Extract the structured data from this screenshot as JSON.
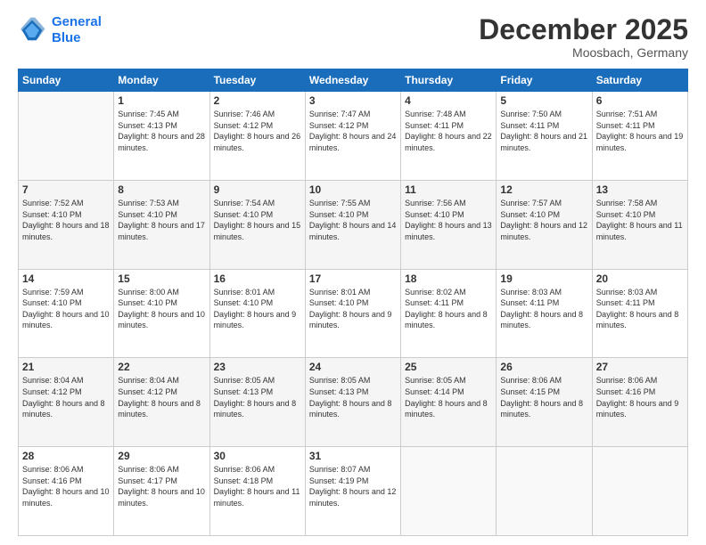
{
  "header": {
    "logo_line1": "General",
    "logo_line2": "Blue",
    "month": "December 2025",
    "location": "Moosbach, Germany"
  },
  "weekdays": [
    "Sunday",
    "Monday",
    "Tuesday",
    "Wednesday",
    "Thursday",
    "Friday",
    "Saturday"
  ],
  "weeks": [
    [
      {
        "day": "",
        "sunrise": "",
        "sunset": "",
        "daylight": ""
      },
      {
        "day": "1",
        "sunrise": "Sunrise: 7:45 AM",
        "sunset": "Sunset: 4:13 PM",
        "daylight": "Daylight: 8 hours and 28 minutes."
      },
      {
        "day": "2",
        "sunrise": "Sunrise: 7:46 AM",
        "sunset": "Sunset: 4:12 PM",
        "daylight": "Daylight: 8 hours and 26 minutes."
      },
      {
        "day": "3",
        "sunrise": "Sunrise: 7:47 AM",
        "sunset": "Sunset: 4:12 PM",
        "daylight": "Daylight: 8 hours and 24 minutes."
      },
      {
        "day": "4",
        "sunrise": "Sunrise: 7:48 AM",
        "sunset": "Sunset: 4:11 PM",
        "daylight": "Daylight: 8 hours and 22 minutes."
      },
      {
        "day": "5",
        "sunrise": "Sunrise: 7:50 AM",
        "sunset": "Sunset: 4:11 PM",
        "daylight": "Daylight: 8 hours and 21 minutes."
      },
      {
        "day": "6",
        "sunrise": "Sunrise: 7:51 AM",
        "sunset": "Sunset: 4:11 PM",
        "daylight": "Daylight: 8 hours and 19 minutes."
      }
    ],
    [
      {
        "day": "7",
        "sunrise": "Sunrise: 7:52 AM",
        "sunset": "Sunset: 4:10 PM",
        "daylight": "Daylight: 8 hours and 18 minutes."
      },
      {
        "day": "8",
        "sunrise": "Sunrise: 7:53 AM",
        "sunset": "Sunset: 4:10 PM",
        "daylight": "Daylight: 8 hours and 17 minutes."
      },
      {
        "day": "9",
        "sunrise": "Sunrise: 7:54 AM",
        "sunset": "Sunset: 4:10 PM",
        "daylight": "Daylight: 8 hours and 15 minutes."
      },
      {
        "day": "10",
        "sunrise": "Sunrise: 7:55 AM",
        "sunset": "Sunset: 4:10 PM",
        "daylight": "Daylight: 8 hours and 14 minutes."
      },
      {
        "day": "11",
        "sunrise": "Sunrise: 7:56 AM",
        "sunset": "Sunset: 4:10 PM",
        "daylight": "Daylight: 8 hours and 13 minutes."
      },
      {
        "day": "12",
        "sunrise": "Sunrise: 7:57 AM",
        "sunset": "Sunset: 4:10 PM",
        "daylight": "Daylight: 8 hours and 12 minutes."
      },
      {
        "day": "13",
        "sunrise": "Sunrise: 7:58 AM",
        "sunset": "Sunset: 4:10 PM",
        "daylight": "Daylight: 8 hours and 11 minutes."
      }
    ],
    [
      {
        "day": "14",
        "sunrise": "Sunrise: 7:59 AM",
        "sunset": "Sunset: 4:10 PM",
        "daylight": "Daylight: 8 hours and 10 minutes."
      },
      {
        "day": "15",
        "sunrise": "Sunrise: 8:00 AM",
        "sunset": "Sunset: 4:10 PM",
        "daylight": "Daylight: 8 hours and 10 minutes."
      },
      {
        "day": "16",
        "sunrise": "Sunrise: 8:01 AM",
        "sunset": "Sunset: 4:10 PM",
        "daylight": "Daylight: 8 hours and 9 minutes."
      },
      {
        "day": "17",
        "sunrise": "Sunrise: 8:01 AM",
        "sunset": "Sunset: 4:10 PM",
        "daylight": "Daylight: 8 hours and 9 minutes."
      },
      {
        "day": "18",
        "sunrise": "Sunrise: 8:02 AM",
        "sunset": "Sunset: 4:11 PM",
        "daylight": "Daylight: 8 hours and 8 minutes."
      },
      {
        "day": "19",
        "sunrise": "Sunrise: 8:03 AM",
        "sunset": "Sunset: 4:11 PM",
        "daylight": "Daylight: 8 hours and 8 minutes."
      },
      {
        "day": "20",
        "sunrise": "Sunrise: 8:03 AM",
        "sunset": "Sunset: 4:11 PM",
        "daylight": "Daylight: 8 hours and 8 minutes."
      }
    ],
    [
      {
        "day": "21",
        "sunrise": "Sunrise: 8:04 AM",
        "sunset": "Sunset: 4:12 PM",
        "daylight": "Daylight: 8 hours and 8 minutes."
      },
      {
        "day": "22",
        "sunrise": "Sunrise: 8:04 AM",
        "sunset": "Sunset: 4:12 PM",
        "daylight": "Daylight: 8 hours and 8 minutes."
      },
      {
        "day": "23",
        "sunrise": "Sunrise: 8:05 AM",
        "sunset": "Sunset: 4:13 PM",
        "daylight": "Daylight: 8 hours and 8 minutes."
      },
      {
        "day": "24",
        "sunrise": "Sunrise: 8:05 AM",
        "sunset": "Sunset: 4:13 PM",
        "daylight": "Daylight: 8 hours and 8 minutes."
      },
      {
        "day": "25",
        "sunrise": "Sunrise: 8:05 AM",
        "sunset": "Sunset: 4:14 PM",
        "daylight": "Daylight: 8 hours and 8 minutes."
      },
      {
        "day": "26",
        "sunrise": "Sunrise: 8:06 AM",
        "sunset": "Sunset: 4:15 PM",
        "daylight": "Daylight: 8 hours and 8 minutes."
      },
      {
        "day": "27",
        "sunrise": "Sunrise: 8:06 AM",
        "sunset": "Sunset: 4:16 PM",
        "daylight": "Daylight: 8 hours and 9 minutes."
      }
    ],
    [
      {
        "day": "28",
        "sunrise": "Sunrise: 8:06 AM",
        "sunset": "Sunset: 4:16 PM",
        "daylight": "Daylight: 8 hours and 10 minutes."
      },
      {
        "day": "29",
        "sunrise": "Sunrise: 8:06 AM",
        "sunset": "Sunset: 4:17 PM",
        "daylight": "Daylight: 8 hours and 10 minutes."
      },
      {
        "day": "30",
        "sunrise": "Sunrise: 8:06 AM",
        "sunset": "Sunset: 4:18 PM",
        "daylight": "Daylight: 8 hours and 11 minutes."
      },
      {
        "day": "31",
        "sunrise": "Sunrise: 8:07 AM",
        "sunset": "Sunset: 4:19 PM",
        "daylight": "Daylight: 8 hours and 12 minutes."
      },
      {
        "day": "",
        "sunrise": "",
        "sunset": "",
        "daylight": ""
      },
      {
        "day": "",
        "sunrise": "",
        "sunset": "",
        "daylight": ""
      },
      {
        "day": "",
        "sunrise": "",
        "sunset": "",
        "daylight": ""
      }
    ]
  ]
}
